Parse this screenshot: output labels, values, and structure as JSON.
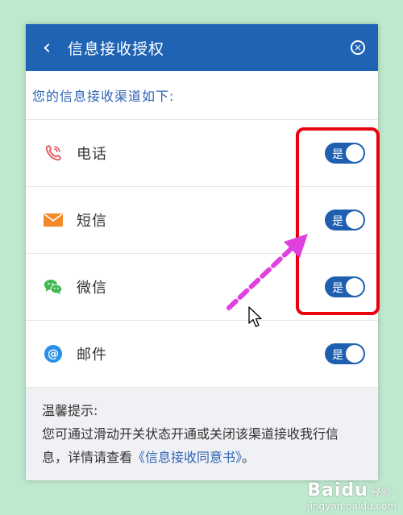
{
  "header": {
    "title": "信息接收授权",
    "back_icon": "‹",
    "close_icon": "×"
  },
  "subtitle": "您的信息接收渠道如下:",
  "channels": [
    {
      "label": "电话",
      "icon": "phone-icon",
      "toggle": "是",
      "color": "#e8505b"
    },
    {
      "label": "短信",
      "icon": "mail-icon",
      "toggle": "是",
      "color": "#f28a2a"
    },
    {
      "label": "微信",
      "icon": "wechat-icon",
      "toggle": "是",
      "color": "#3fb851"
    },
    {
      "label": "邮件",
      "icon": "at-icon",
      "toggle": "是",
      "color": "#2a8fe6"
    }
  ],
  "notice": {
    "title": "温馨提示:",
    "text": "您可通过滑动开关状态开通或关闭该渠道接收我行信息，详情请查看",
    "link": "《信息接收同意书》",
    "end": "。"
  },
  "watermark": {
    "brand": "Bai",
    "paw": "du",
    "sub": "经验",
    "url": "jingyan.baidu.com"
  },
  "colors": {
    "accent": "#1f63b5",
    "toggle": "#1e5fb0",
    "annotation_box": "#e8000f",
    "annotation_arrow": "#e040e0"
  }
}
